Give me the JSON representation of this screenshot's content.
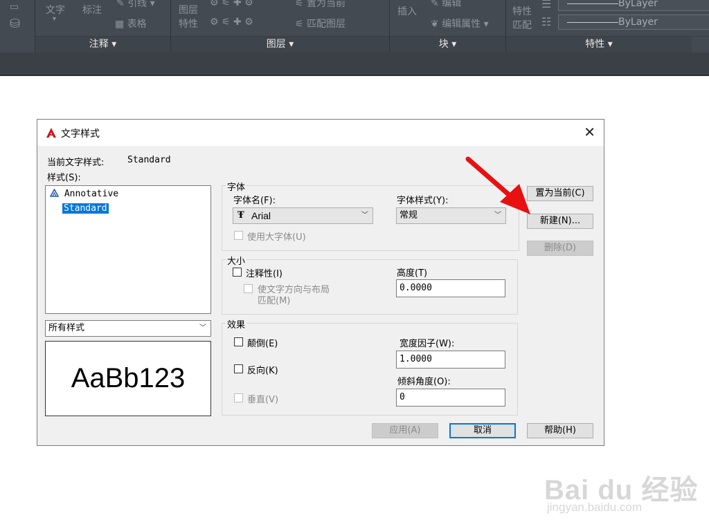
{
  "ribbon": {
    "text_items": {
      "wenzi": "文字",
      "biaozhu": "标注",
      "yinxian": "引线",
      "biaoge": "表格",
      "tuceng": "图层",
      "texing_l": "特性",
      "zhiwei": "置为当前",
      "pipei_tuceng": "匹配图层",
      "charu": "插入",
      "bianji": "编辑",
      "bianji_shuxing": "编辑属性",
      "texing_r": "特性",
      "pipei_r": "匹配",
      "bylayer1": "ByLayer",
      "bylayer2": "ByLayer"
    },
    "groups": [
      "注释 ▾",
      "图层 ▾",
      "块 ▾",
      "特性 ▾"
    ]
  },
  "dialog": {
    "title": "文字样式",
    "current_style_label": "当前文字样式:",
    "current_style_value": "Standard",
    "styles_label": "样式(S):",
    "styles": [
      "Annotative",
      "Standard"
    ],
    "filter_value": "所有样式",
    "preview_text": "AaBb123",
    "font_group": "字体",
    "font_name_label": "字体名(F):",
    "font_name_value": "Arial",
    "font_style_label": "字体样式(Y):",
    "font_style_value": "常规",
    "use_bigfont_label": "使用大字体(U)",
    "size_group": "大小",
    "annotative_label": "注释性(I)",
    "match_layout_label_1": "使文字方向与布局",
    "match_layout_label_2": "匹配(M)",
    "height_label": "高度(T)",
    "height_value": "0.0000",
    "effects_group": "效果",
    "upside_down_label": "颠倒(E)",
    "backwards_label": "反向(K)",
    "vertical_label": "垂直(V)",
    "width_factor_label": "宽度因子(W):",
    "width_factor_value": "1.0000",
    "oblique_label": "倾斜角度(O):",
    "oblique_value": "0",
    "btn_set_current": "置为当前(C)",
    "btn_new": "新建(N)...",
    "btn_delete": "删除(D)",
    "btn_apply": "应用(A)",
    "btn_cancel": "取消",
    "btn_help": "帮助(H)"
  },
  "watermark": {
    "brand": "Bai du 经验",
    "url": "jingyan.baidu.com"
  },
  "colors": {
    "ribbon_bg": "#444a52",
    "selection": "#0078d7",
    "arrow": "#e81010",
    "autocad_logo": "#c4161c"
  }
}
